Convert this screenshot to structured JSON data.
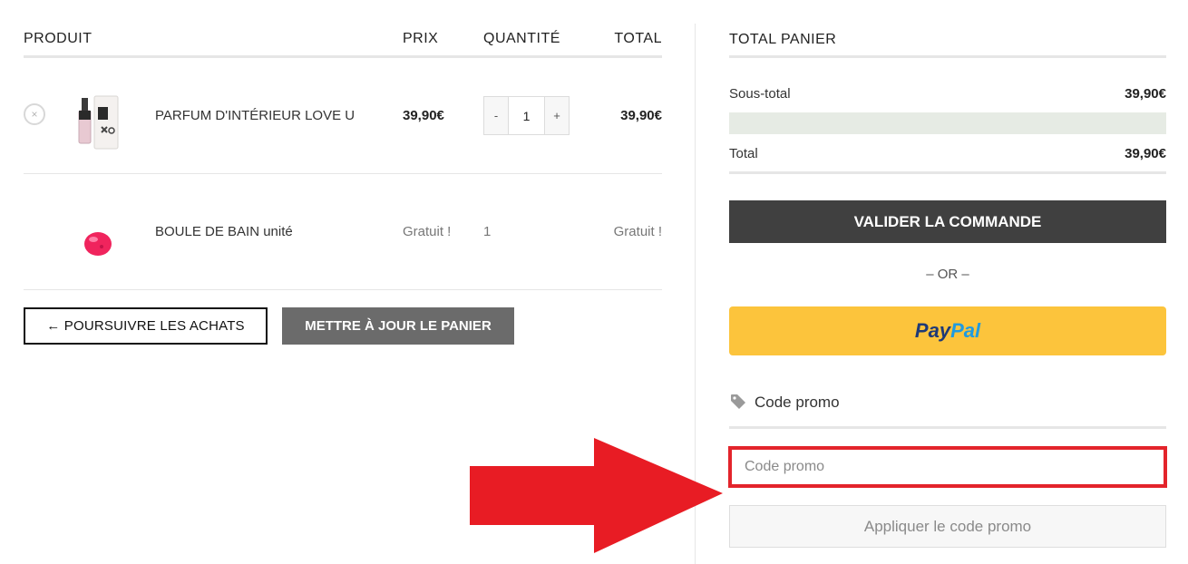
{
  "table": {
    "headers": {
      "product": "PRODUIT",
      "price": "PRIX",
      "quantity": "QUANTITÉ",
      "total": "TOTAL"
    },
    "rows": [
      {
        "name": "PARFUM D'INTÉRIEUR LOVE U",
        "price": "39,90€",
        "quantity": "1",
        "total": "39,90€",
        "remove": "×",
        "qty_minus": "-",
        "qty_plus": "+"
      },
      {
        "name": "BOULE DE BAIN unité",
        "price": "Gratuit !",
        "quantity": "1",
        "total": "Gratuit !"
      }
    ]
  },
  "actions": {
    "continue_shopping": "← POURSUIVRE LES ACHATS",
    "update_cart": "METTRE À JOUR LE PANIER"
  },
  "summary": {
    "title": "TOTAL PANIER",
    "subtotal_label": "Sous-total",
    "subtotal_value": "39,90€",
    "total_label": "Total",
    "total_value": "39,90€",
    "checkout_button": "VALIDER LA COMMANDE",
    "or_separator": "– OR –",
    "paypal": {
      "part1": "Pay",
      "part2": "Pal"
    }
  },
  "promo": {
    "title": "Code promo",
    "placeholder": "Code promo",
    "apply_button": "Appliquer le code promo"
  },
  "colors": {
    "highlight_red": "#e3242b",
    "checkout_bg": "#404040",
    "paypal_yellow": "#fcc43c",
    "paypal_dark_blue": "#1f3a76",
    "paypal_light_blue": "#1f9be0"
  },
  "icons": {
    "remove": "close-circle-icon",
    "promo": "tag-icon",
    "annotation": "arrow-right-icon"
  }
}
